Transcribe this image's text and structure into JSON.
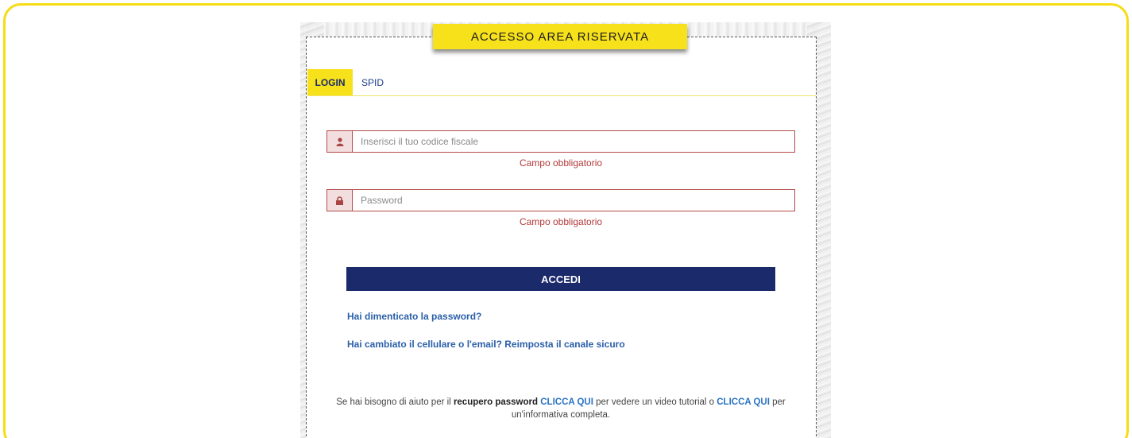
{
  "banner": {
    "title": "ACCESSO AREA RISERVATA"
  },
  "tabs": [
    {
      "label": "LOGIN",
      "active": true
    },
    {
      "label": "SPID",
      "active": false
    }
  ],
  "form": {
    "cf_placeholder": "Inserisci il tuo codice fiscale",
    "cf_value": "",
    "cf_error": "Campo obbligatorio",
    "password_placeholder": "Password",
    "password_value": "",
    "password_error": "Campo obbligatorio",
    "submit_label": "ACCEDI"
  },
  "links": {
    "forgot_password": "Hai dimenticato la password?",
    "reset_channel": "Hai cambiato il cellulare o l'email? Reimposta il canale sicuro"
  },
  "help": {
    "t1": "Se hai bisogno di aiuto per il ",
    "t2": "recupero password",
    "t3": " ",
    "link1": "CLICCA QUI",
    "t4": " per vedere un video tutorial o ",
    "link2": "CLICCA QUI",
    "t5": " per un'informativa completa."
  },
  "colors": {
    "accent_yellow": "#f7e11a",
    "primary_navy": "#1b2a6b",
    "error_red": "#b33a3a",
    "link_blue": "#2a5fa8"
  },
  "icons": {
    "user": "user-icon",
    "lock": "lock-icon"
  }
}
